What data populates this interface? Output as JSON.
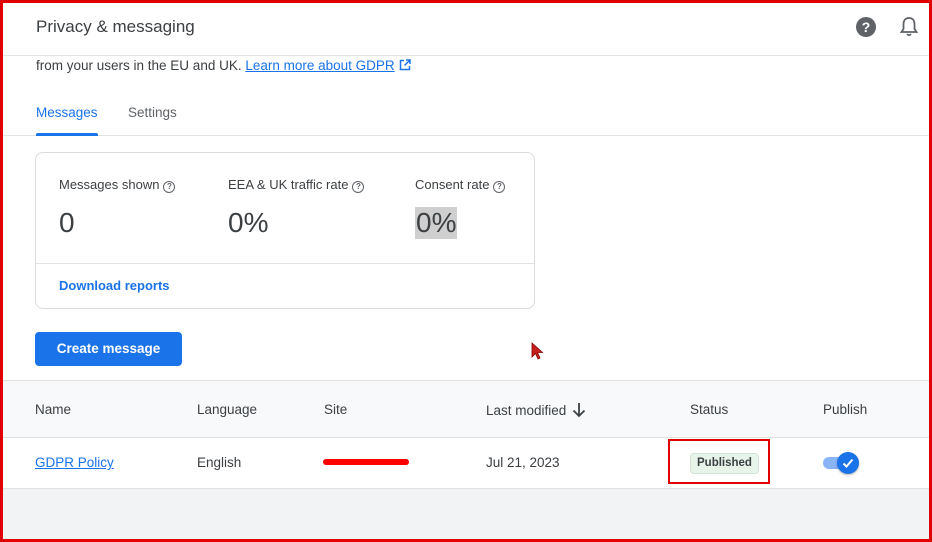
{
  "header": {
    "title": "Privacy & messaging",
    "help_icon": "help-icon",
    "bell_icon": "notifications-icon"
  },
  "intro": {
    "text": "from your users in the EU and UK. ",
    "link_text": "Learn more about GDPR",
    "link_icon": "external-link-icon"
  },
  "tabs": [
    {
      "label": "Messages",
      "active": true
    },
    {
      "label": "Settings",
      "active": false
    }
  ],
  "stats": [
    {
      "label": "Messages shown",
      "value": "0"
    },
    {
      "label": "EEA & UK traffic rate",
      "value": "0%"
    },
    {
      "label": "Consent rate",
      "value": "0%"
    }
  ],
  "download_reports": "Download reports",
  "create_button": "Create message",
  "table": {
    "headers": {
      "name": "Name",
      "language": "Language",
      "site": "Site",
      "last_modified": "Last modified",
      "status": "Status",
      "publish": "Publish"
    },
    "rows": [
      {
        "name": "GDPR Policy",
        "language": "English",
        "site": "",
        "last_modified": "Jul 21, 2023",
        "status": "Published",
        "publish": true
      }
    ]
  },
  "colors": {
    "accent": "#1a73e8",
    "annotation": "#e00000",
    "status_bg": "#e6f4ea"
  }
}
